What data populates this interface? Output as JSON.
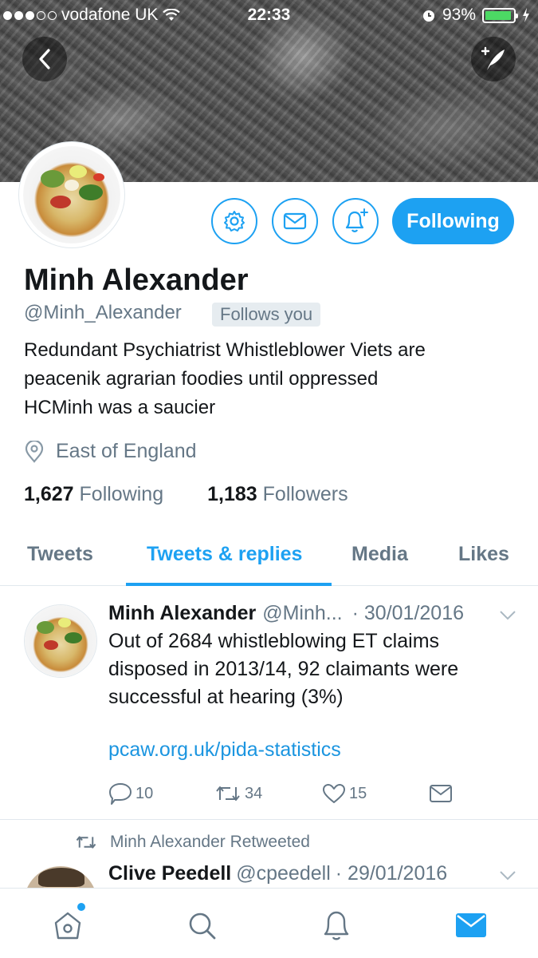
{
  "status_bar": {
    "carrier": "vodafone UK",
    "time": "22:33",
    "battery": "93%",
    "battery_level": 0.93
  },
  "header": {
    "back_icon": "chevron-left-icon",
    "compose_icon": "compose-quill-icon"
  },
  "profile": {
    "name": "Minh Alexander",
    "handle": "@Minh_Alexander",
    "follows_you": "Follows you",
    "bio_lines": [
      "Redundant Psychiatrist Whistleblower Viets are",
      "peacenik agrarian foodies until oppressed",
      "HCMinh was a saucier"
    ],
    "location": "East of England",
    "following_count": "1,627",
    "following_label": "Following",
    "followers_count": "1,183",
    "followers_label": "Followers",
    "follow_button": "Following"
  },
  "tabs": [
    {
      "label": "Tweets",
      "active": false
    },
    {
      "label": "Tweets & replies",
      "active": true
    },
    {
      "label": "Media",
      "active": false
    },
    {
      "label": "Likes",
      "active": false
    }
  ],
  "tweets": [
    {
      "author": "Minh Alexander",
      "handle": "@Minh...",
      "date": "· 30/01/2016",
      "text_lines": [
        "Out of 2684 whistleblowing ET claims",
        "disposed in 2013/14, 92 claimants were",
        "successful at hearing (3%)"
      ],
      "link": "pcaw.org.uk/pida-statistics",
      "replies": "10",
      "retweets": "34",
      "likes": "15"
    },
    {
      "retweeted_by": "Minh Alexander Retweeted",
      "author": "Clive Peedell",
      "handle": "@cpeedell",
      "date": "· 29/01/2016"
    }
  ],
  "colors": {
    "accent": "#1da1f2",
    "secondary_text": "#657786",
    "link": "#1b95e0",
    "battery": "#4cd964"
  }
}
